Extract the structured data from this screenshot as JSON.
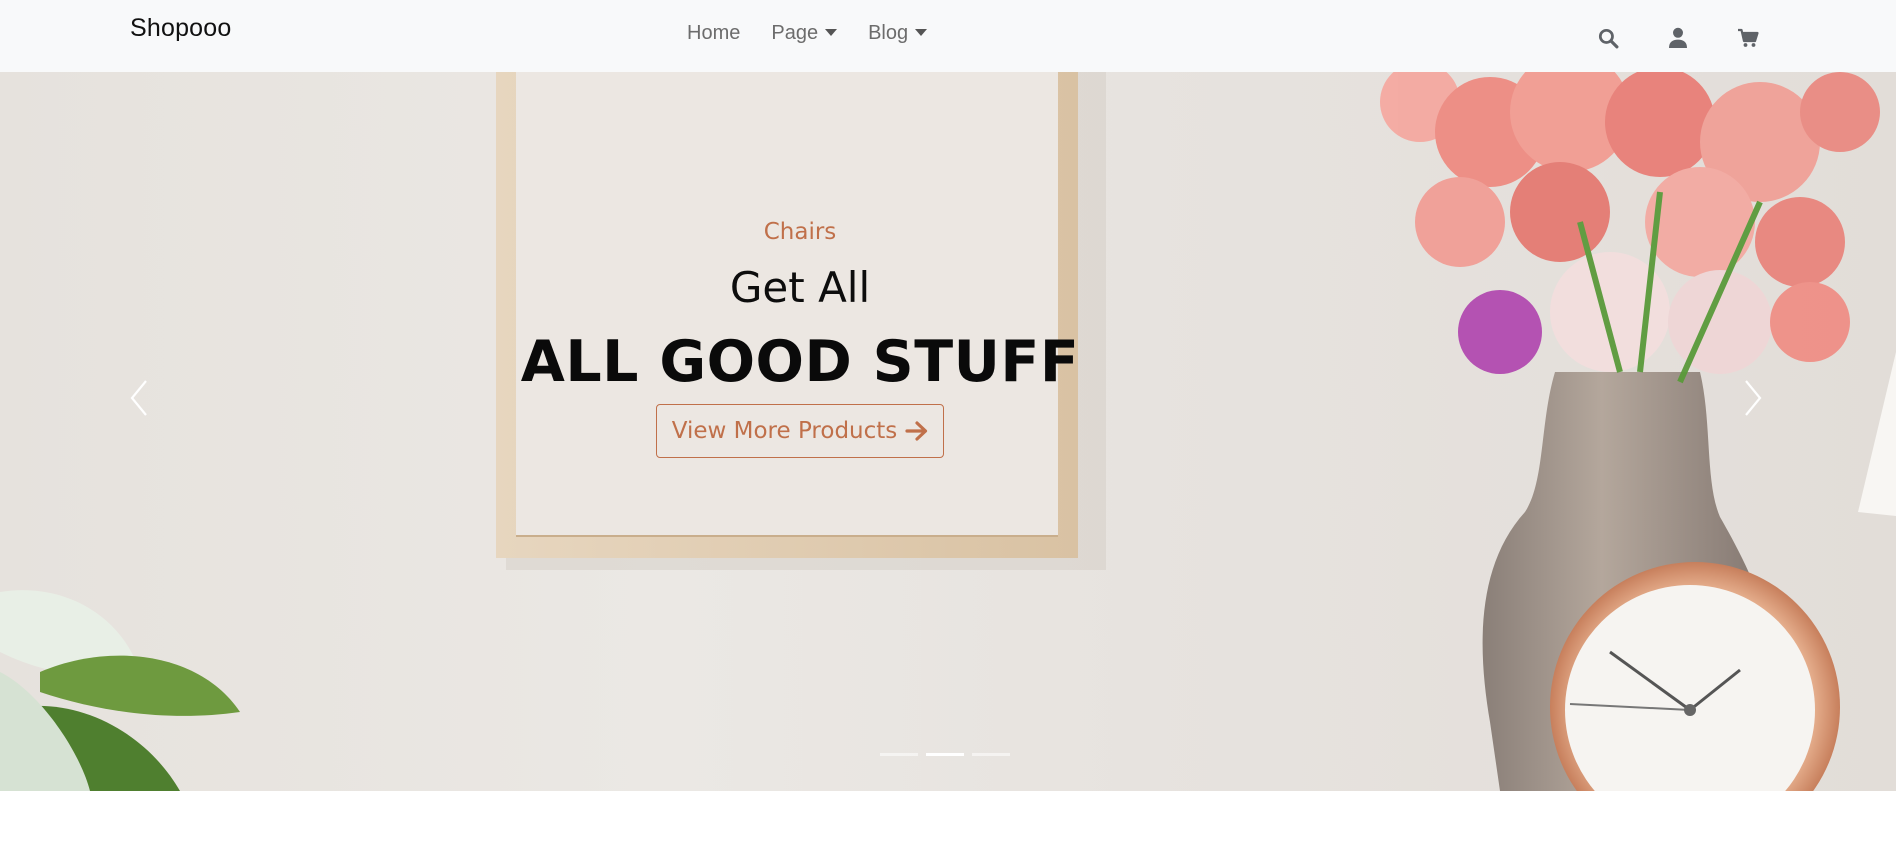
{
  "navbar": {
    "brand": "Shopooo",
    "links": [
      {
        "label": "Home",
        "has_dropdown": false
      },
      {
        "label": "Page",
        "has_dropdown": true
      },
      {
        "label": "Blog",
        "has_dropdown": true
      }
    ],
    "icons": [
      "search-icon",
      "user-icon",
      "cart-icon"
    ]
  },
  "hero": {
    "subtitle": "Chairs",
    "heading": "Get All",
    "title": "ALL GOOD STUFF",
    "cta_label": "View More Products",
    "indicators_count": 3,
    "active_indicator": 2
  },
  "colors": {
    "accent": "#c0704a",
    "navbar_bg": "#f8f9fa",
    "nav_text": "#6c6c6c"
  }
}
